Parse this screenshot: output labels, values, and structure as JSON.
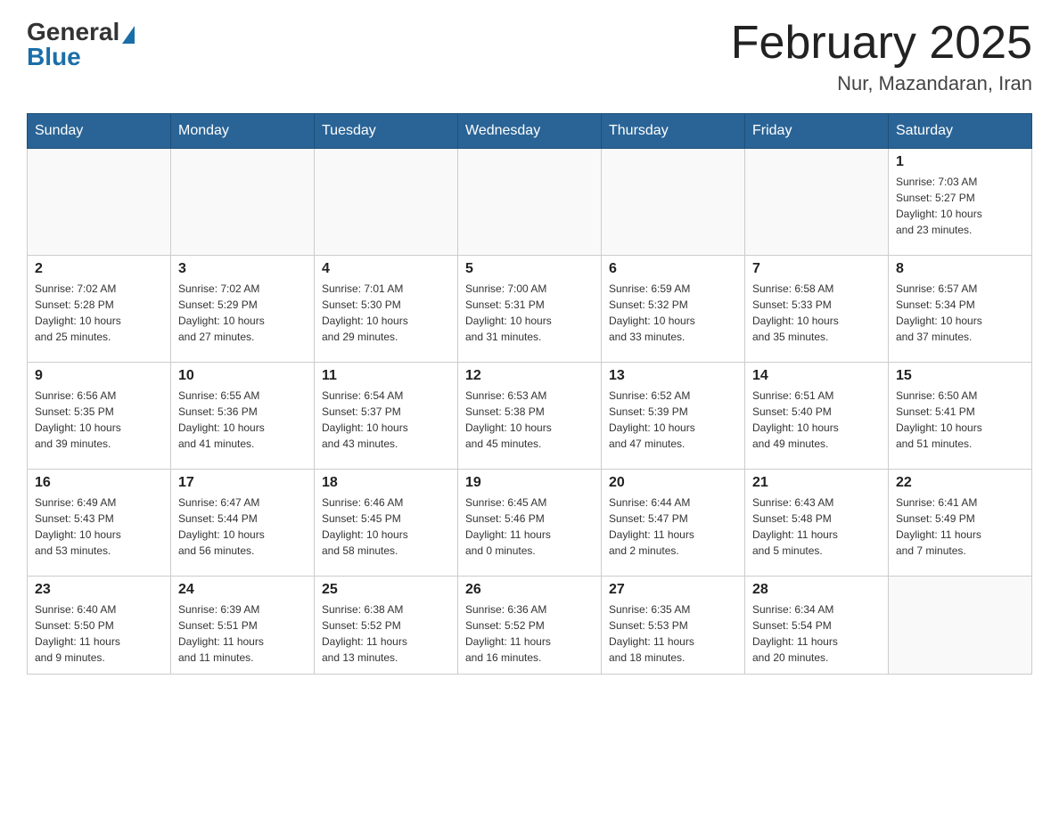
{
  "header": {
    "logo_general": "General",
    "logo_blue": "Blue",
    "month_title": "February 2025",
    "location": "Nur, Mazandaran, Iran"
  },
  "days_of_week": [
    "Sunday",
    "Monday",
    "Tuesday",
    "Wednesday",
    "Thursday",
    "Friday",
    "Saturday"
  ],
  "weeks": [
    [
      {
        "day": "",
        "info": ""
      },
      {
        "day": "",
        "info": ""
      },
      {
        "day": "",
        "info": ""
      },
      {
        "day": "",
        "info": ""
      },
      {
        "day": "",
        "info": ""
      },
      {
        "day": "",
        "info": ""
      },
      {
        "day": "1",
        "info": "Sunrise: 7:03 AM\nSunset: 5:27 PM\nDaylight: 10 hours\nand 23 minutes."
      }
    ],
    [
      {
        "day": "2",
        "info": "Sunrise: 7:02 AM\nSunset: 5:28 PM\nDaylight: 10 hours\nand 25 minutes."
      },
      {
        "day": "3",
        "info": "Sunrise: 7:02 AM\nSunset: 5:29 PM\nDaylight: 10 hours\nand 27 minutes."
      },
      {
        "day": "4",
        "info": "Sunrise: 7:01 AM\nSunset: 5:30 PM\nDaylight: 10 hours\nand 29 minutes."
      },
      {
        "day": "5",
        "info": "Sunrise: 7:00 AM\nSunset: 5:31 PM\nDaylight: 10 hours\nand 31 minutes."
      },
      {
        "day": "6",
        "info": "Sunrise: 6:59 AM\nSunset: 5:32 PM\nDaylight: 10 hours\nand 33 minutes."
      },
      {
        "day": "7",
        "info": "Sunrise: 6:58 AM\nSunset: 5:33 PM\nDaylight: 10 hours\nand 35 minutes."
      },
      {
        "day": "8",
        "info": "Sunrise: 6:57 AM\nSunset: 5:34 PM\nDaylight: 10 hours\nand 37 minutes."
      }
    ],
    [
      {
        "day": "9",
        "info": "Sunrise: 6:56 AM\nSunset: 5:35 PM\nDaylight: 10 hours\nand 39 minutes."
      },
      {
        "day": "10",
        "info": "Sunrise: 6:55 AM\nSunset: 5:36 PM\nDaylight: 10 hours\nand 41 minutes."
      },
      {
        "day": "11",
        "info": "Sunrise: 6:54 AM\nSunset: 5:37 PM\nDaylight: 10 hours\nand 43 minutes."
      },
      {
        "day": "12",
        "info": "Sunrise: 6:53 AM\nSunset: 5:38 PM\nDaylight: 10 hours\nand 45 minutes."
      },
      {
        "day": "13",
        "info": "Sunrise: 6:52 AM\nSunset: 5:39 PM\nDaylight: 10 hours\nand 47 minutes."
      },
      {
        "day": "14",
        "info": "Sunrise: 6:51 AM\nSunset: 5:40 PM\nDaylight: 10 hours\nand 49 minutes."
      },
      {
        "day": "15",
        "info": "Sunrise: 6:50 AM\nSunset: 5:41 PM\nDaylight: 10 hours\nand 51 minutes."
      }
    ],
    [
      {
        "day": "16",
        "info": "Sunrise: 6:49 AM\nSunset: 5:43 PM\nDaylight: 10 hours\nand 53 minutes."
      },
      {
        "day": "17",
        "info": "Sunrise: 6:47 AM\nSunset: 5:44 PM\nDaylight: 10 hours\nand 56 minutes."
      },
      {
        "day": "18",
        "info": "Sunrise: 6:46 AM\nSunset: 5:45 PM\nDaylight: 10 hours\nand 58 minutes."
      },
      {
        "day": "19",
        "info": "Sunrise: 6:45 AM\nSunset: 5:46 PM\nDaylight: 11 hours\nand 0 minutes."
      },
      {
        "day": "20",
        "info": "Sunrise: 6:44 AM\nSunset: 5:47 PM\nDaylight: 11 hours\nand 2 minutes."
      },
      {
        "day": "21",
        "info": "Sunrise: 6:43 AM\nSunset: 5:48 PM\nDaylight: 11 hours\nand 5 minutes."
      },
      {
        "day": "22",
        "info": "Sunrise: 6:41 AM\nSunset: 5:49 PM\nDaylight: 11 hours\nand 7 minutes."
      }
    ],
    [
      {
        "day": "23",
        "info": "Sunrise: 6:40 AM\nSunset: 5:50 PM\nDaylight: 11 hours\nand 9 minutes."
      },
      {
        "day": "24",
        "info": "Sunrise: 6:39 AM\nSunset: 5:51 PM\nDaylight: 11 hours\nand 11 minutes."
      },
      {
        "day": "25",
        "info": "Sunrise: 6:38 AM\nSunset: 5:52 PM\nDaylight: 11 hours\nand 13 minutes."
      },
      {
        "day": "26",
        "info": "Sunrise: 6:36 AM\nSunset: 5:52 PM\nDaylight: 11 hours\nand 16 minutes."
      },
      {
        "day": "27",
        "info": "Sunrise: 6:35 AM\nSunset: 5:53 PM\nDaylight: 11 hours\nand 18 minutes."
      },
      {
        "day": "28",
        "info": "Sunrise: 6:34 AM\nSunset: 5:54 PM\nDaylight: 11 hours\nand 20 minutes."
      },
      {
        "day": "",
        "info": ""
      }
    ]
  ]
}
